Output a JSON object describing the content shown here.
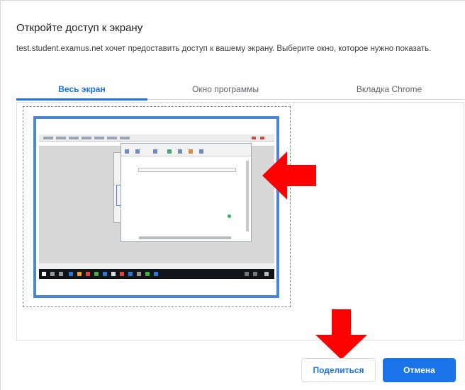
{
  "dialog": {
    "title": "Откройте доступ к экрану",
    "description": "test.student.examus.net хочет предоставить доступ к вашему экрану. Выберите окно, которое нужно показать."
  },
  "tabs": [
    {
      "label": "Весь экран",
      "active": true
    },
    {
      "label": "Окно программы",
      "active": false
    },
    {
      "label": "Вкладка Chrome",
      "active": false
    }
  ],
  "buttons": {
    "share_label": "Поделиться",
    "cancel_label": "Отмена"
  },
  "colors": {
    "accent": "#1a73e8",
    "annotation_arrow": "#ff0000",
    "selection_border": "#4a86d8"
  },
  "icons": {
    "annotation_right": "arrow-left-pointing-icon",
    "annotation_down": "arrow-down-pointing-icon"
  }
}
